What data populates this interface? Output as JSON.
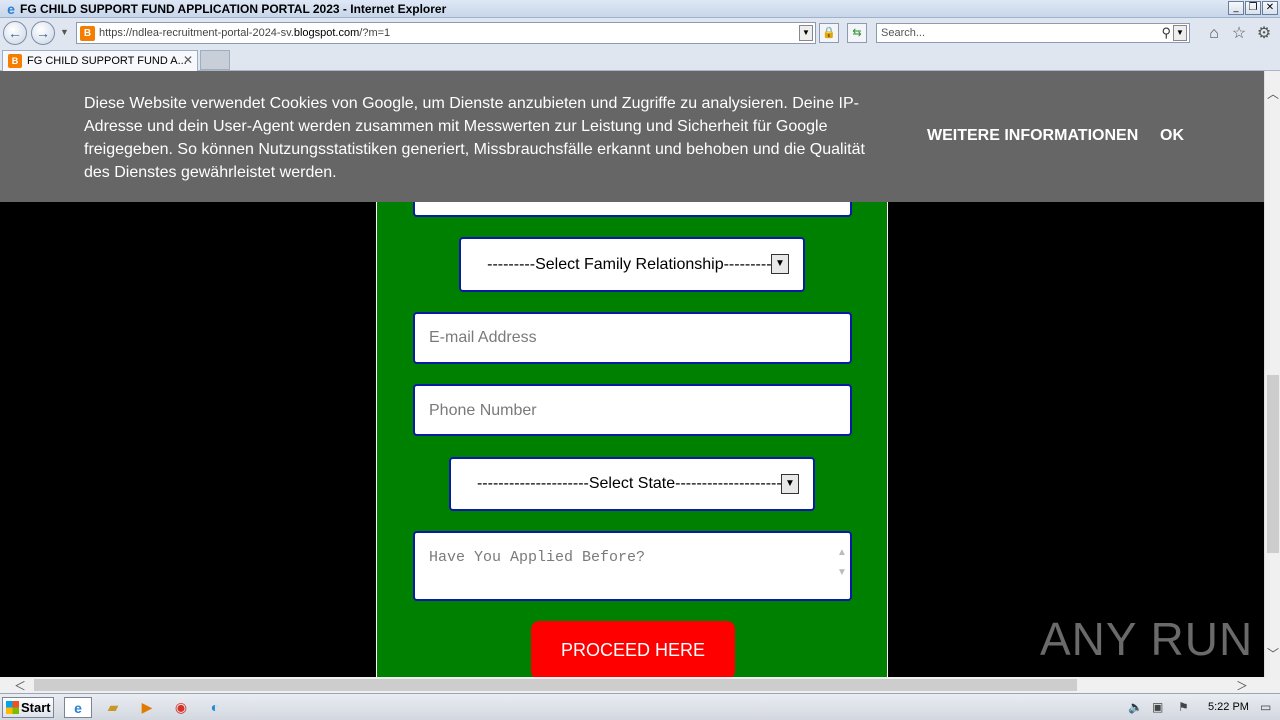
{
  "window": {
    "title": "FG CHILD SUPPORT FUND APPLICATION PORTAL 2023 - Internet Explorer"
  },
  "address_bar": {
    "url_prefix": "https://ndlea-recruitment-portal-2024-sv.",
    "url_domain": "blogspot.com",
    "url_suffix": "/?m=1"
  },
  "search": {
    "placeholder": "Search..."
  },
  "tabs": [
    {
      "label": "FG CHILD SUPPORT FUND A..."
    }
  ],
  "cookie_banner": {
    "message": "Diese Website verwendet Cookies von Google, um Dienste anzubieten und Zugriffe zu analysieren. Deine IP-Adresse und dein User-Agent werden zusammen mit Messwerten zur Leistung und Sicherheit für Google freigegeben. So können Nutzungsstatistiken generiert, Missbrauchsfälle erkannt und behoben und die Qualität des Dienstes gewährleistet werden.",
    "more_label": "WEITERE INFORMATIONEN",
    "ok_label": "OK"
  },
  "form": {
    "relationship_select": "---------Select Family Relationship----------",
    "email_placeholder": "E-mail Address",
    "phone_placeholder": "Phone Number",
    "state_select": "---------------------Select State---------------------",
    "applied_placeholder": "Have You Applied Before?",
    "proceed_label": "PROCEED HERE"
  },
  "watermark": "ANY RUN",
  "taskbar": {
    "start_label": "Start",
    "clock": "5:22 PM"
  },
  "icons": {
    "ie": "ie-icon",
    "blogger": "blogger-icon",
    "folder": "folder-icon",
    "media": "media-player-icon",
    "chrome": "chrome-icon",
    "edge": "edge-icon"
  },
  "colors": {
    "form_bg": "#008000",
    "field_border": "#0a1aa8",
    "proceed_bg": "#ff0000",
    "cookie_bg": "#666666"
  }
}
